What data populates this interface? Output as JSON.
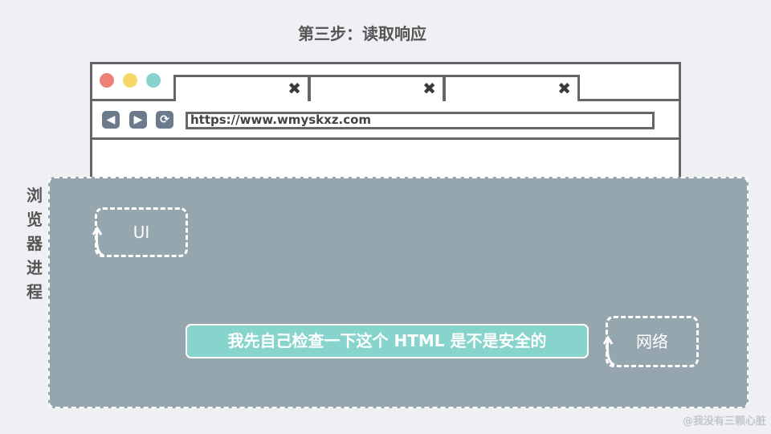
{
  "title": "第三步：读取响应",
  "browser": {
    "tabs": [
      {
        "close": "✖"
      },
      {
        "close": "✖"
      },
      {
        "close": "✖"
      }
    ],
    "nav": {
      "back": "◀",
      "forward": "▶",
      "reload": "⟳"
    },
    "url": "https://www.wmyskxz.com"
  },
  "process": {
    "label": [
      "浏",
      "览",
      "器",
      "进",
      "程"
    ],
    "ui_label": "UI",
    "network_label": "网络",
    "message": "我先自己检查一下这个 HTML 是不是安全的"
  },
  "colors": {
    "process_bg": "#95a6ae",
    "message_bg": "#86d4cc",
    "dot_red": "#f07f7a",
    "dot_yellow": "#f8d769",
    "dot_teal": "#86d4cc"
  },
  "watermark": "@我没有三颗心脏"
}
